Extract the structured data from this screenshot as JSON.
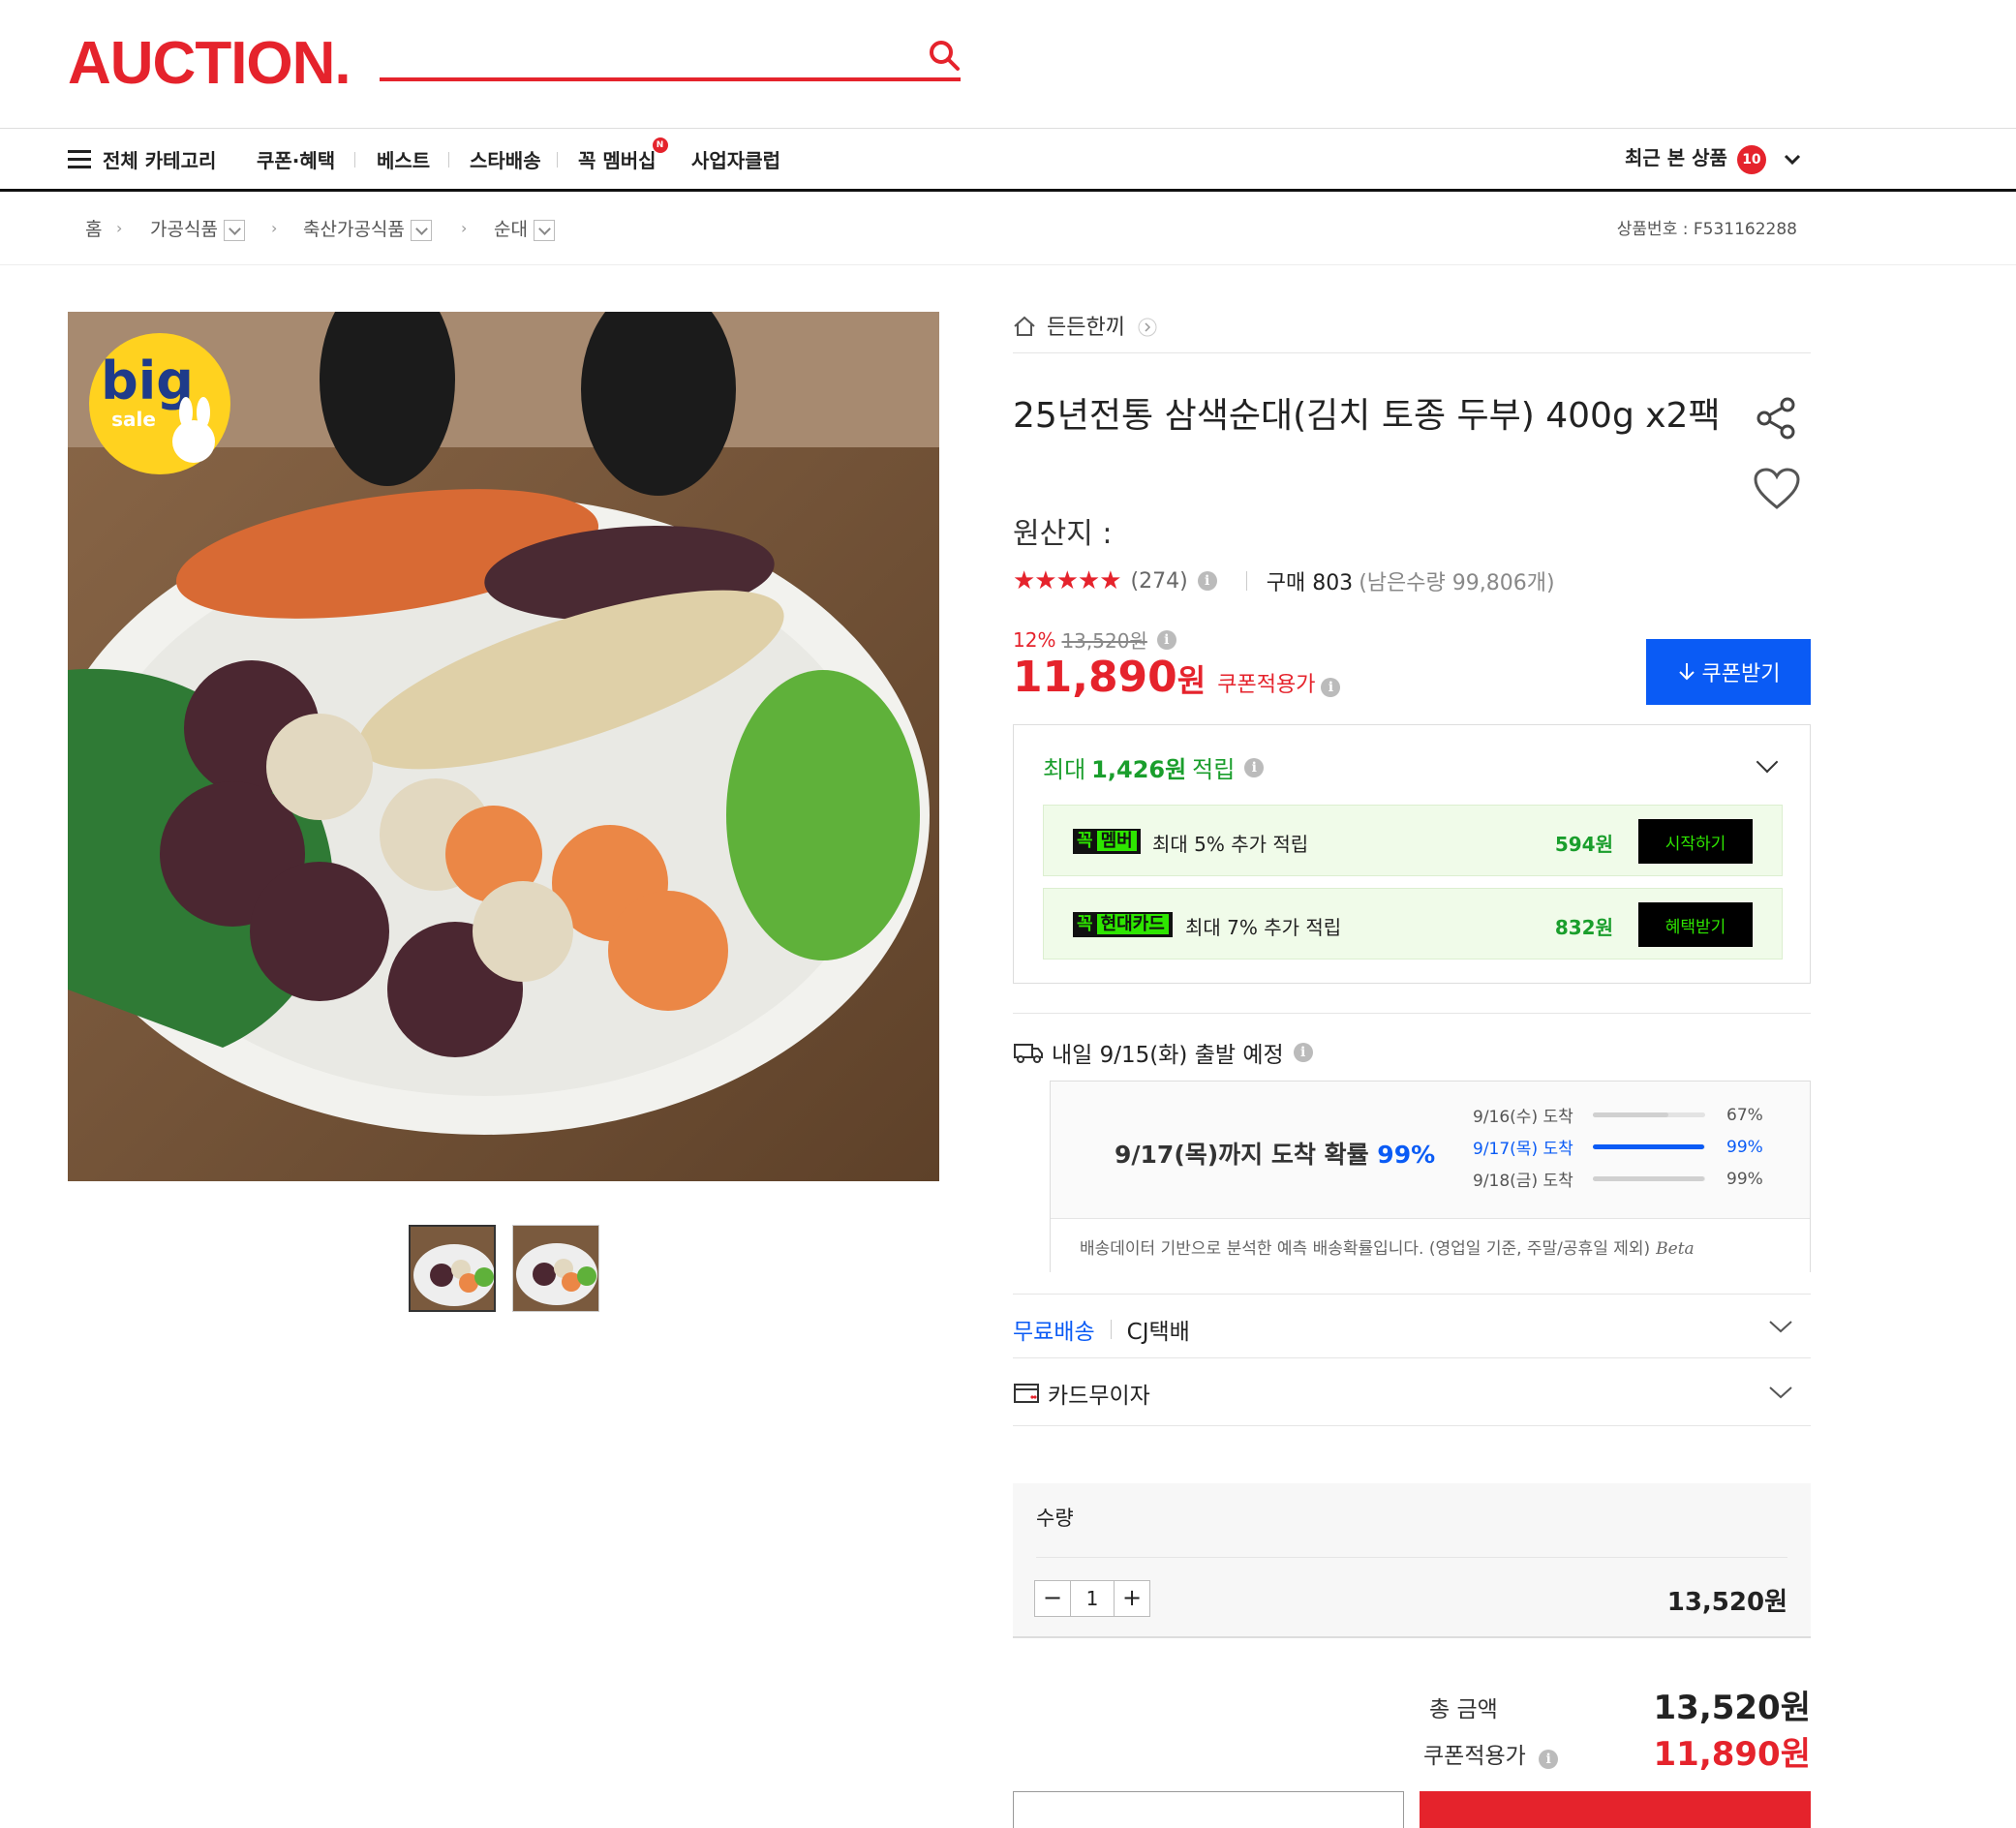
{
  "header": {
    "logo": "AUCTION.",
    "search": {
      "value": "",
      "placeholder": ""
    }
  },
  "gnb": {
    "all_category": "전체 카테고리",
    "items": [
      "쿠폰·혜택",
      "베스트",
      "스타배송",
      "꼭 멤버십",
      "사업자클럽"
    ],
    "membership_badge": "N",
    "recent_label": "최근 본 상품",
    "recent_count": "10"
  },
  "breadcrumb": {
    "home": "홈",
    "levels": [
      "가공식품",
      "축산가공식품",
      "순대"
    ],
    "product_no": "상품번호 : F531162288"
  },
  "image": {
    "badge_big": "big",
    "badge_sale": "sale",
    "thumbnail_count": 2
  },
  "product": {
    "store": "든든한끼",
    "title": "25년전통 삼색순대(김치 토종 두부) 400g x2팩",
    "origin": "원산지 :",
    "stars": "★★★★★",
    "rating_value": 4.5,
    "review_count": "(274)",
    "purchase": "구매 803",
    "remaining": "(남은수량 99,806개)",
    "discount_rate": "12%",
    "original_price": "13,520원",
    "price": "11,890",
    "price_unit": "원",
    "price_label": "쿠폰적용가",
    "coupon_button": "쿠폰받기"
  },
  "points": {
    "prefix": "최대",
    "amount": "1,426원",
    "suffix": "적립",
    "benefits": [
      {
        "tag_a": "꼭",
        "tag_b": "멤버",
        "desc": "최대 5% 추가 적립",
        "amount": "594원",
        "button": "시작하기"
      },
      {
        "tag_a": "꼭",
        "tag_b": "현대카드",
        "desc": "최대 7% 추가 적립",
        "amount": "832원",
        "button": "혜택받기"
      }
    ]
  },
  "shipping": {
    "departure": "내일 9/15(화) 출발 예정",
    "eta_main_prefix": "9/17(목)까지 도착 확률",
    "eta_main_pct": "99%",
    "rows": [
      {
        "date": "9/16(수) 도착",
        "pct": "67%",
        "value": 67
      },
      {
        "date": "9/17(목) 도착",
        "pct": "99%",
        "value": 99
      },
      {
        "date": "9/18(금) 도착",
        "pct": "99%",
        "value": 99
      }
    ],
    "note": "배송데이터 기반으로 분석한 예측 배송확률입니다. (영업일 기준, 주말/공휴일 제외)",
    "beta": "Beta",
    "free": "무료배송",
    "courier": "CJ택배",
    "card": "카드무이자"
  },
  "quantity": {
    "label": "수량",
    "minus": "−",
    "value": "1",
    "plus": "+",
    "price": "13,520원"
  },
  "total": {
    "label": "총 금액",
    "value": "13,520원",
    "coupon_label": "쿠폰적용가",
    "coupon_value": "11,890원"
  },
  "colors": {
    "brand": "#e5232c",
    "accent_blue": "#0a5bf5",
    "points_green": "#1a9e2c"
  }
}
